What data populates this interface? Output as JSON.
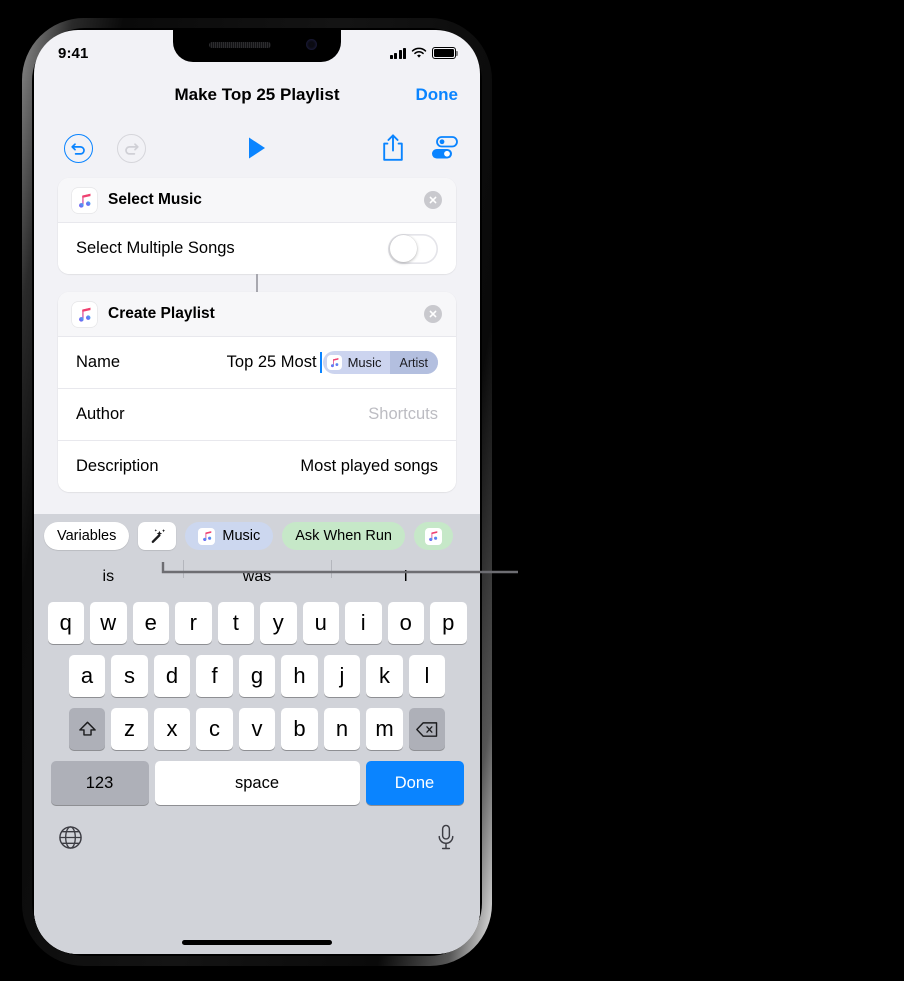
{
  "status_bar": {
    "time": "9:41",
    "cellular_icon": "signal-bars-icon",
    "wifi_icon": "wifi-icon",
    "battery_icon": "battery-icon"
  },
  "nav": {
    "title": "Make Top 25 Playlist",
    "done_label": "Done"
  },
  "toolbar": {
    "undo_icon": "undo-icon",
    "redo_icon": "redo-icon",
    "play_icon": "play-icon",
    "share_icon": "share-icon",
    "settings_icon": "settings-toggles-icon",
    "accent_color": "#0a84ff",
    "disabled_color": "#d6d6db"
  },
  "actions": [
    {
      "title": "Select Music",
      "app_icon": "apple-music-icon",
      "remove_icon": "remove-circle-icon",
      "params": [
        {
          "label": "Select Multiple Songs",
          "type": "toggle",
          "value": "off"
        }
      ]
    },
    {
      "title": "Create Playlist",
      "app_icon": "apple-music-icon",
      "remove_icon": "remove-circle-icon",
      "params": [
        {
          "label": "Name",
          "type": "text",
          "value": "Top 25 Most"
        },
        {
          "label": "Author",
          "type": "text",
          "value": "Shortcuts",
          "placeholder": true
        },
        {
          "label": "Description",
          "type": "text",
          "value": "Most played songs"
        }
      ]
    }
  ],
  "name_token": {
    "icon": "apple-music-icon",
    "label": "Music",
    "segment": "Artist",
    "fill_color": "#ccd4ef",
    "segment_color": "#b3bfdf"
  },
  "accessory_bar": {
    "variables_label": "Variables",
    "magic_wand_icon": "magic-wand-icon",
    "pills": [
      {
        "label": "Music",
        "icon": "apple-music-icon",
        "style": "blue"
      },
      {
        "label": "Ask When Run",
        "icon": "",
        "style": "green"
      },
      {
        "label": "",
        "icon": "apple-music-icon",
        "style": "green"
      }
    ]
  },
  "predictive_bar": {
    "suggestions": [
      "is",
      "was",
      "I"
    ]
  },
  "keyboard": {
    "row1": [
      "q",
      "w",
      "e",
      "r",
      "t",
      "y",
      "u",
      "i",
      "o",
      "p"
    ],
    "row2": [
      "a",
      "s",
      "d",
      "f",
      "g",
      "h",
      "j",
      "k",
      "l"
    ],
    "row3_letters": [
      "z",
      "x",
      "c",
      "v",
      "b",
      "n",
      "m"
    ],
    "shift_icon": "shift-arrow-icon",
    "backspace_icon": "backspace-icon",
    "numbers_label": "123",
    "space_label": "space",
    "return_label": "Done",
    "globe_icon": "globe-icon",
    "mic_icon": "microphone-icon",
    "background_color": "#d1d3d9",
    "return_key_color": "#0a84ff"
  },
  "callout": {
    "target_icon": "magic-wand-icon",
    "line_color": "#6d6d72"
  }
}
